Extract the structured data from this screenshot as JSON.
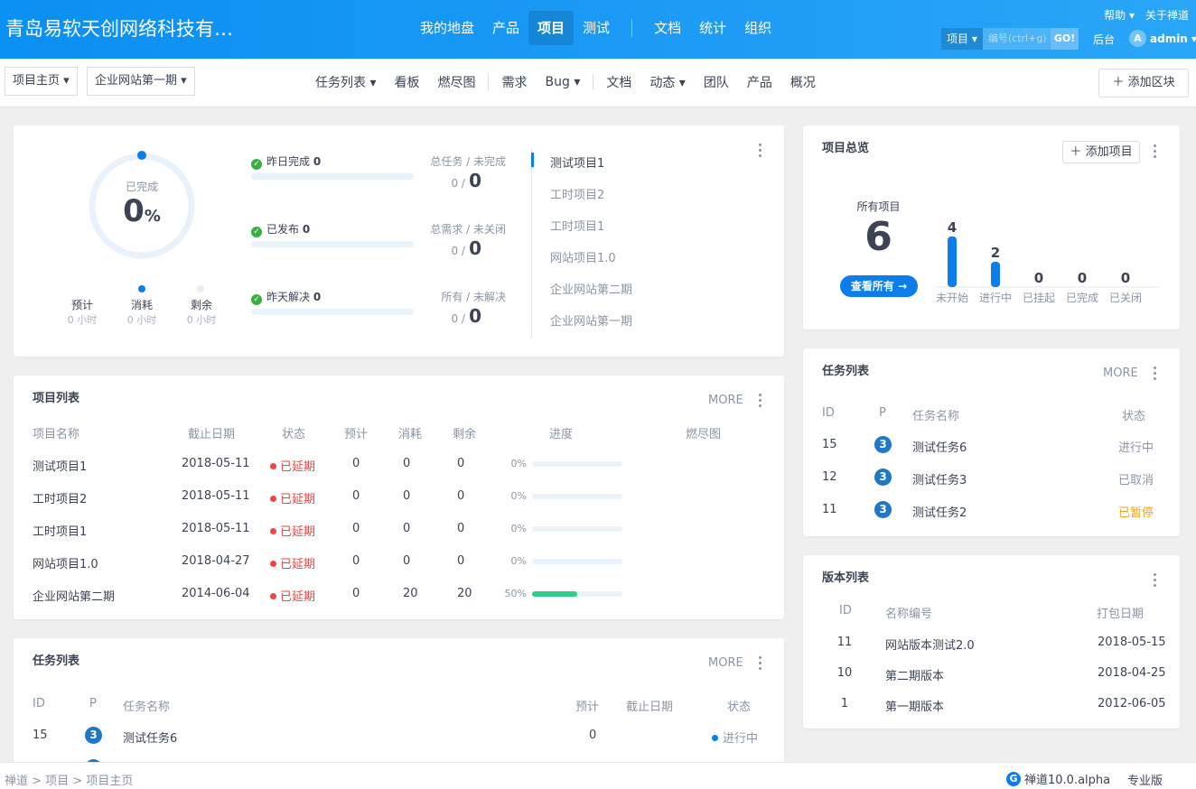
{
  "brand": "青岛易软天创网络科技有…",
  "mainnav": [
    "我的地盘",
    "产品",
    "项目",
    "测试",
    "文档",
    "统计",
    "组织"
  ],
  "top_right": {
    "help": "帮助",
    "about": "关于禅道",
    "search_type": "项目",
    "search_placeholder": "编号(ctrl+g)",
    "go": "GO!",
    "admin_link": "后台",
    "avatar": "A",
    "username": "admin"
  },
  "breadcrumb": {
    "home": "项目主页",
    "current": "企业网站第一期"
  },
  "subnav": [
    "任务列表",
    "看板",
    "燃尽图",
    "需求",
    "Bug",
    "文档",
    "动态",
    "团队",
    "产品",
    "概况"
  ],
  "add_block": "添加区块",
  "stats": {
    "ring_label": "已完成",
    "percent": "0",
    "percent_unit": "%",
    "estimate": {
      "label": "预计",
      "value": "0 小时"
    },
    "consumed": {
      "label": "消耗",
      "value": "0 小时"
    },
    "left": {
      "label": "剩余",
      "value": "0 小时"
    },
    "rows": [
      {
        "label": "昨日完成",
        "count": "0",
        "right_label": "总任务 / 未完成",
        "total": "0 /",
        "open": "0"
      },
      {
        "label": "已发布",
        "count": "0",
        "right_label": "总需求 / 未关闭",
        "total": "0 /",
        "open": "0"
      },
      {
        "label": "昨天解决",
        "count": "0",
        "right_label": "所有 / 未解决",
        "total": "0 /",
        "open": "0"
      }
    ],
    "projects": [
      "测试项目1",
      "工时项目2",
      "工时项目1",
      "网站项目1.0",
      "企业网站第二期",
      "企业网站第一期"
    ]
  },
  "overview": {
    "title": "项目总览",
    "add": "添加项目",
    "all_label": "所有项目",
    "all_count": "6",
    "view_all": "查看所有",
    "chart_data": {
      "type": "bar",
      "categories": [
        "未开始",
        "进行中",
        "已挂起",
        "已完成",
        "已关闭"
      ],
      "values": [
        4,
        2,
        0,
        0,
        0
      ]
    }
  },
  "project_list": {
    "title": "项目列表",
    "more": "MORE",
    "headers": [
      "项目名称",
      "截止日期",
      "状态",
      "预计",
      "消耗",
      "剩余",
      "进度",
      "燃尽图"
    ],
    "rows": [
      {
        "name": "测试项目1",
        "date": "2018-05-11",
        "status": "已延期",
        "est": "0",
        "con": "0",
        "left": "0",
        "pct": "0%",
        "p": 0
      },
      {
        "name": "工时项目2",
        "date": "2018-05-11",
        "status": "已延期",
        "est": "0",
        "con": "0",
        "left": "0",
        "pct": "0%",
        "p": 0
      },
      {
        "name": "工时项目1",
        "date": "2018-05-11",
        "status": "已延期",
        "est": "0",
        "con": "0",
        "left": "0",
        "pct": "0%",
        "p": 0
      },
      {
        "name": "网站项目1.0",
        "date": "2018-04-27",
        "status": "已延期",
        "est": "0",
        "con": "0",
        "left": "0",
        "pct": "0%",
        "p": 0
      },
      {
        "name": "企业网站第二期",
        "date": "2014-06-04",
        "status": "已延期",
        "est": "0",
        "con": "20",
        "left": "20",
        "pct": "50%",
        "p": 0.5
      }
    ]
  },
  "task_list_main": {
    "title": "任务列表",
    "more": "MORE",
    "headers": [
      "ID",
      "P",
      "任务名称",
      "预计",
      "截止日期",
      "状态"
    ],
    "rows": [
      {
        "id": "15",
        "p": "3",
        "name": "测试任务6",
        "est": "0",
        "date": "",
        "status": "进行中"
      }
    ]
  },
  "task_list_side": {
    "title": "任务列表",
    "more": "MORE",
    "headers": [
      "ID",
      "P",
      "任务名称",
      "状态"
    ],
    "rows": [
      {
        "id": "15",
        "p": "3",
        "name": "测试任务6",
        "status": "进行中",
        "color": "#8b95a5"
      },
      {
        "id": "12",
        "p": "3",
        "name": "测试任务3",
        "status": "已取消",
        "color": "#8b95a5"
      },
      {
        "id": "11",
        "p": "3",
        "name": "测试任务2",
        "status": "已暂停",
        "color": "#f1a325"
      }
    ]
  },
  "build_list": {
    "title": "版本列表",
    "headers": [
      "ID",
      "名称编号",
      "打包日期"
    ],
    "rows": [
      {
        "id": "11",
        "name": "网站版本测试2.0",
        "date": "2018-05-15"
      },
      {
        "id": "10",
        "name": "第二期版本",
        "date": "2018-04-25"
      },
      {
        "id": "1",
        "name": "第一期版本",
        "date": "2012-06-05"
      }
    ]
  },
  "footer": {
    "crumbs": [
      "禅道",
      "项目",
      "项目主页"
    ],
    "version": "禅道10.0.alpha",
    "edition": "专业版"
  },
  "colors": {
    "primary": "#0c7dea",
    "accent_green": "#2fcf87",
    "danger": "#e44",
    "warning": "#f1a325"
  }
}
